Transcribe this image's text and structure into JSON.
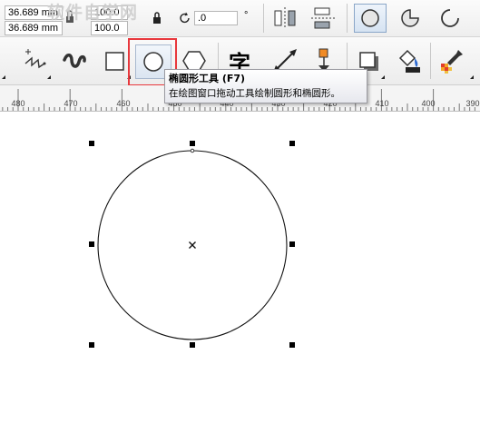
{
  "property_bar": {
    "width_value": "36.689 mm",
    "height_value": "36.689 mm",
    "scale_x": "100.0",
    "scale_y": "100.0",
    "rotation_value": ".0",
    "degree_unit": "°"
  },
  "watermark": "软件自学网",
  "toolbox": {
    "text_tool_glyph": "字"
  },
  "tooltip": {
    "title": "椭圆形工具 (F7)",
    "description": "在绘图窗口拖动工具绘制圆形和椭圆形。"
  },
  "ruler": {
    "labels": [
      "480",
      "470",
      "460",
      "450",
      "440",
      "430",
      "420",
      "410",
      "400",
      "390"
    ]
  }
}
